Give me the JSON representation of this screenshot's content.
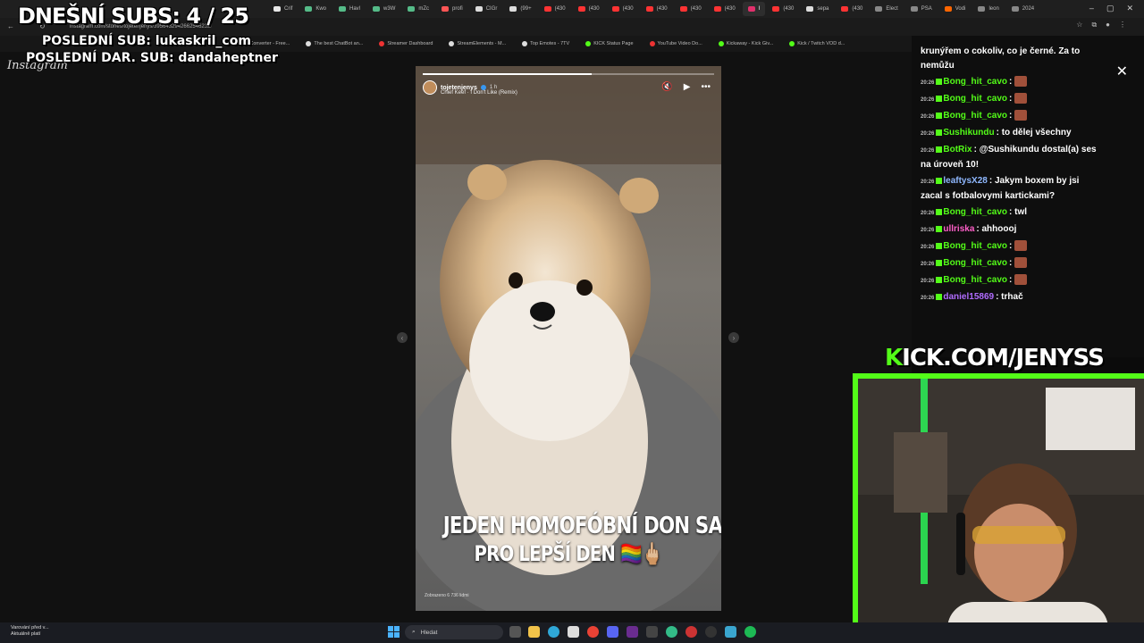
{
  "overlay": {
    "subs_title": "DNEŠNÍ SUBS: 4 / 25",
    "last_sub": "POSLEDNÍ SUB: lukaskril_com",
    "last_gift_sub": "POSLEDNÍ DAR. SUB: dandaheptner"
  },
  "browser": {
    "url": "instagram.com/stories/tojetenjenys/3956432942662546232/",
    "tabs": [
      {
        "label": "Crif",
        "color": "#e8e8e8"
      },
      {
        "label": "Kwo",
        "color": "#5b8"
      },
      {
        "label": "Havl",
        "color": "#5b8"
      },
      {
        "label": "w3W",
        "color": "#5b8"
      },
      {
        "label": "mZc",
        "color": "#5b8"
      },
      {
        "label": "profi",
        "color": "#f55"
      },
      {
        "label": "CIGr",
        "color": "#ddd"
      },
      {
        "label": "(99+",
        "color": "#ddd"
      },
      {
        "label": "(430",
        "color": "#f33"
      },
      {
        "label": "(430",
        "color": "#f33"
      },
      {
        "label": "(430",
        "color": "#f33"
      },
      {
        "label": "(430",
        "color": "#f33"
      },
      {
        "label": "(430",
        "color": "#f33"
      },
      {
        "label": "(430",
        "color": "#f33"
      },
      {
        "label": "I",
        "color": "#e1306c"
      },
      {
        "label": "(430",
        "color": "#f33"
      },
      {
        "label": "sepa",
        "color": "#ddd"
      },
      {
        "label": "(430",
        "color": "#f33"
      },
      {
        "label": "Elect",
        "color": "#888"
      },
      {
        "label": "PSA",
        "color": "#888"
      },
      {
        "label": "Vodi",
        "color": "#f60"
      },
      {
        "label": "leon",
        "color": "#888"
      },
      {
        "label": "2024",
        "color": "#888"
      }
    ],
    "bookmarks": [
      {
        "label": "File Converter - Free...",
        "color": "#888"
      },
      {
        "label": "The best ChatBot an...",
        "color": "#ddd"
      },
      {
        "label": "Streamer Dashboard",
        "color": "#e33"
      },
      {
        "label": "StreamElements - M...",
        "color": "#ddd"
      },
      {
        "label": "Top Emotes - 7TV",
        "color": "#ddd"
      },
      {
        "label": "KICK Status Page",
        "color": "#53fc18"
      },
      {
        "label": "YouTube Video Do...",
        "color": "#e33"
      },
      {
        "label": "Kickaway - Kick Giv...",
        "color": "#53fc18"
      },
      {
        "label": "Kick / Twitch VOD d...",
        "color": "#53fc18"
      }
    ]
  },
  "instagram": {
    "logo": "Instagram",
    "story": {
      "username": "tojetenjenys",
      "time": "1 h",
      "music": "Chief Keef · I Don't Like (Remix)",
      "caption_line1": "JEDEN HOMOFÓBNÍ DON SALIERI",
      "caption_line2": "PRO LEPŠÍ DEN 🏳️‍🌈🖕🏼",
      "viewers": "Zobrazeno 6 736 lidmi",
      "progress": 0.58
    }
  },
  "chat": {
    "continuation": "krunýřem o cokoliv, co je černé. Za to nemůžu",
    "messages": [
      {
        "time": "20:26",
        "user": "Bong_hit_cavo",
        "user_color": "#53fc18",
        "text": ":",
        "emote": true
      },
      {
        "time": "20:26",
        "user": "Bong_hit_cavo",
        "user_color": "#53fc18",
        "text": ":",
        "emote": true
      },
      {
        "time": "20:26",
        "user": "Bong_hit_cavo",
        "user_color": "#53fc18",
        "text": ":",
        "emote": true
      },
      {
        "time": "20:26",
        "user": "Sushikundu",
        "user_color": "#53fc18",
        "text": ": to dělej všechny",
        "emote": false
      },
      {
        "time": "20:26",
        "user": "BotRix",
        "user_color": "#53fc18",
        "text": ": @Sushikundu dostal(a) ses na úroveň 10!",
        "emote": false
      },
      {
        "time": "20:26",
        "user": "leaftysX28",
        "user_color": "#8fb8ff",
        "text": ": Jakym boxem by jsi zacal s fotbalovymi kartickami?",
        "emote": false
      },
      {
        "time": "20:26",
        "user": "Bong_hit_cavo",
        "user_color": "#53fc18",
        "text": ": twl",
        "emote": false
      },
      {
        "time": "20:26",
        "user": "ullriska",
        "user_color": "#ff5fc8",
        "text": ": ahhoooj",
        "emote": false
      },
      {
        "time": "20:26",
        "user": "Bong_hit_cavo",
        "user_color": "#53fc18",
        "text": ":",
        "emote": true
      },
      {
        "time": "20:26",
        "user": "Bong_hit_cavo",
        "user_color": "#53fc18",
        "text": ":",
        "emote": true
      },
      {
        "time": "20:26",
        "user": "Bong_hit_cavo",
        "user_color": "#53fc18",
        "text": ":",
        "emote": true
      },
      {
        "time": "20:26",
        "user": "daniel15869",
        "user_color": "#b16cff",
        "text": ": trhač",
        "emote": false
      }
    ]
  },
  "cam": {
    "kick_k": "K",
    "kick_rest": "ICK.COM/JENYSS",
    "accent": "#53fc18"
  },
  "taskbar": {
    "warning_line1": "Varování před v...",
    "warning_line2": "Aktuálně platí",
    "search_placeholder": "Hledat"
  }
}
